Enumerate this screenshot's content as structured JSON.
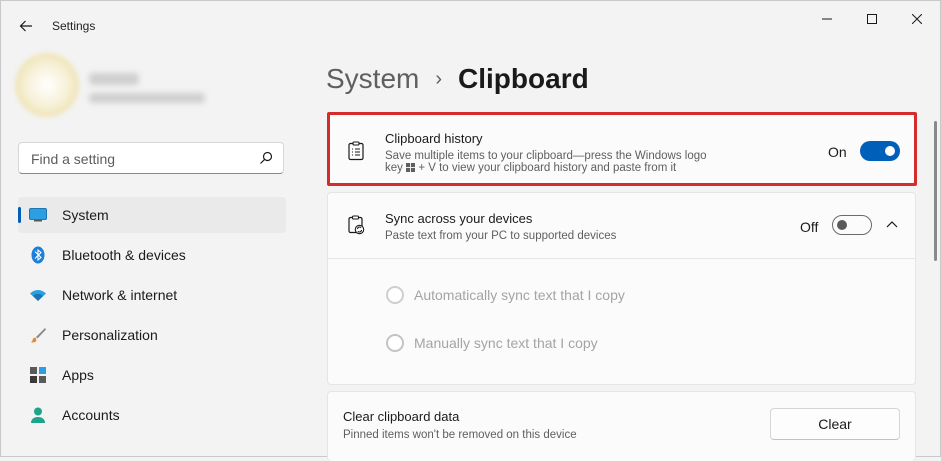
{
  "window": {
    "title": "Settings"
  },
  "search": {
    "placeholder": "Find a setting"
  },
  "sidebar": {
    "items": [
      {
        "label": "System",
        "icon": "monitor-icon",
        "active": true
      },
      {
        "label": "Bluetooth & devices",
        "icon": "bluetooth-icon"
      },
      {
        "label": "Network & internet",
        "icon": "wifi-icon"
      },
      {
        "label": "Personalization",
        "icon": "brush-icon"
      },
      {
        "label": "Apps",
        "icon": "apps-icon"
      },
      {
        "label": "Accounts",
        "icon": "person-icon"
      }
    ]
  },
  "breadcrumb": {
    "parent": "System",
    "separator": "›",
    "current": "Clipboard"
  },
  "clipboard_history": {
    "title": "Clipboard history",
    "desc_line1": "Save multiple items to your clipboard—press the Windows logo",
    "desc_line2_a": "key",
    "desc_line2_b": "+ V to view your clipboard history and paste from it",
    "state_label": "On",
    "enabled": true
  },
  "sync": {
    "title": "Sync across your devices",
    "desc": "Paste text from your PC to supported devices",
    "state_label": "Off",
    "enabled": false,
    "options": [
      {
        "label": "Automatically sync text that I copy"
      },
      {
        "label": "Manually sync text that I copy"
      }
    ]
  },
  "clear_data": {
    "title": "Clear clipboard data",
    "desc": "Pinned items won't be removed on this device",
    "button_label": "Clear"
  },
  "colors": {
    "accent": "#005fb8",
    "highlight": "#d52b2b"
  }
}
